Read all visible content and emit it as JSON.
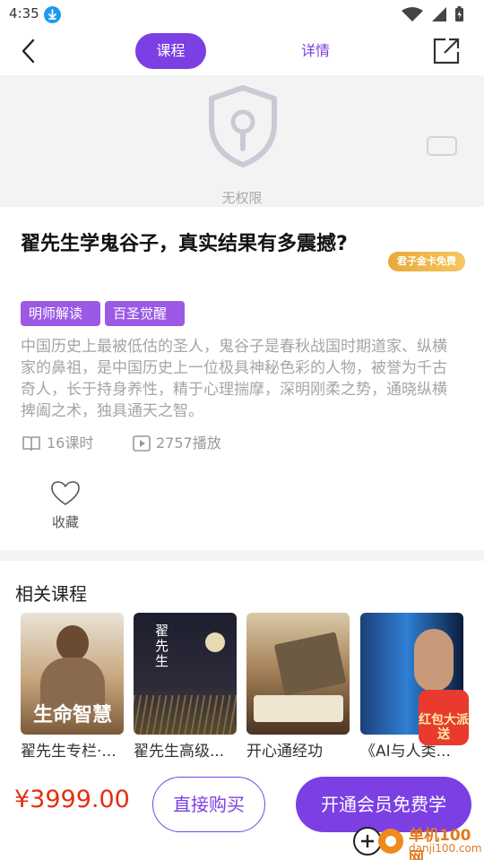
{
  "status": {
    "time": "4:35"
  },
  "tabs": {
    "course": "课程",
    "detail": "详情"
  },
  "player": {
    "no_permission": "无权限"
  },
  "course": {
    "title": "翟先生学鬼谷子，真实结果有多震撼?",
    "vip_badge": "君子金卡免费",
    "tags": [
      "明师解读",
      "百圣觉醒"
    ],
    "description": "中国历史上最被低估的圣人，鬼谷子是春秋战国时期道家、纵横家的鼻祖，是中国历史上一位极具神秘色彩的人物，被誉为千古奇人，长于持身养性，精于心理揣摩，深明刚柔之势，通晓纵横捭阖之术，独具通天之智。",
    "lessons": "16课时",
    "plays": "2757播放",
    "favorite_label": "收藏"
  },
  "related": {
    "title": "相关课程",
    "items": [
      {
        "name": "翟先生专栏·...",
        "cover_text": "生命智慧"
      },
      {
        "name": "翟先生高级...",
        "cover_text": "翟先生"
      },
      {
        "name": "开心通经功",
        "cover_text": ""
      },
      {
        "name": "《AI与人类...",
        "cover_text": ""
      }
    ],
    "red_packet": "红包大派送"
  },
  "bottom": {
    "price": "¥3999.00",
    "buy_label": "直接购买",
    "vip_label": "开通会员免费学"
  },
  "watermark": {
    "name": "单机100网",
    "url": "danji100.com"
  },
  "colors": {
    "accent": "#7b3fe4",
    "price": "#e52e12",
    "tag": "#9b59e6"
  }
}
